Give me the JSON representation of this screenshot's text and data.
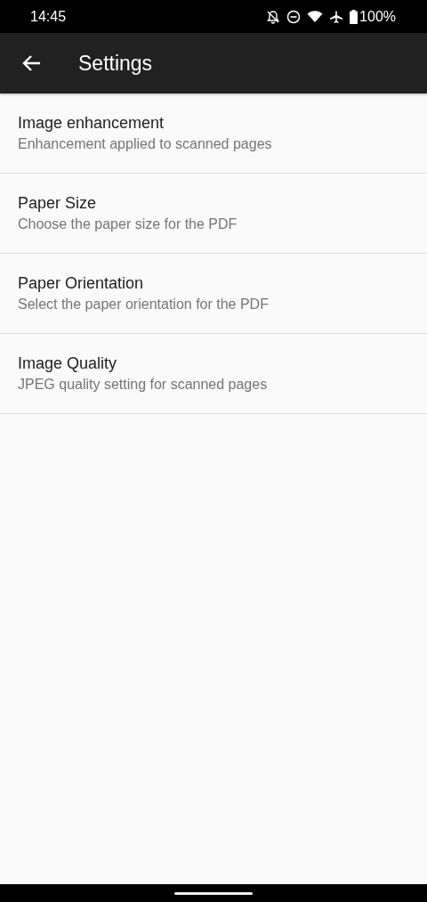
{
  "status_bar": {
    "time": "14:45",
    "battery": "100%"
  },
  "app_bar": {
    "title": "Settings"
  },
  "preferences": [
    {
      "title": "Image enhancement",
      "summary": "Enhancement applied to scanned pages"
    },
    {
      "title": "Paper Size",
      "summary": "Choose the paper size for the PDF"
    },
    {
      "title": "Paper Orientation",
      "summary": "Select the paper orientation for the PDF"
    },
    {
      "title": "Image Quality",
      "summary": "JPEG quality setting for scanned pages"
    }
  ]
}
